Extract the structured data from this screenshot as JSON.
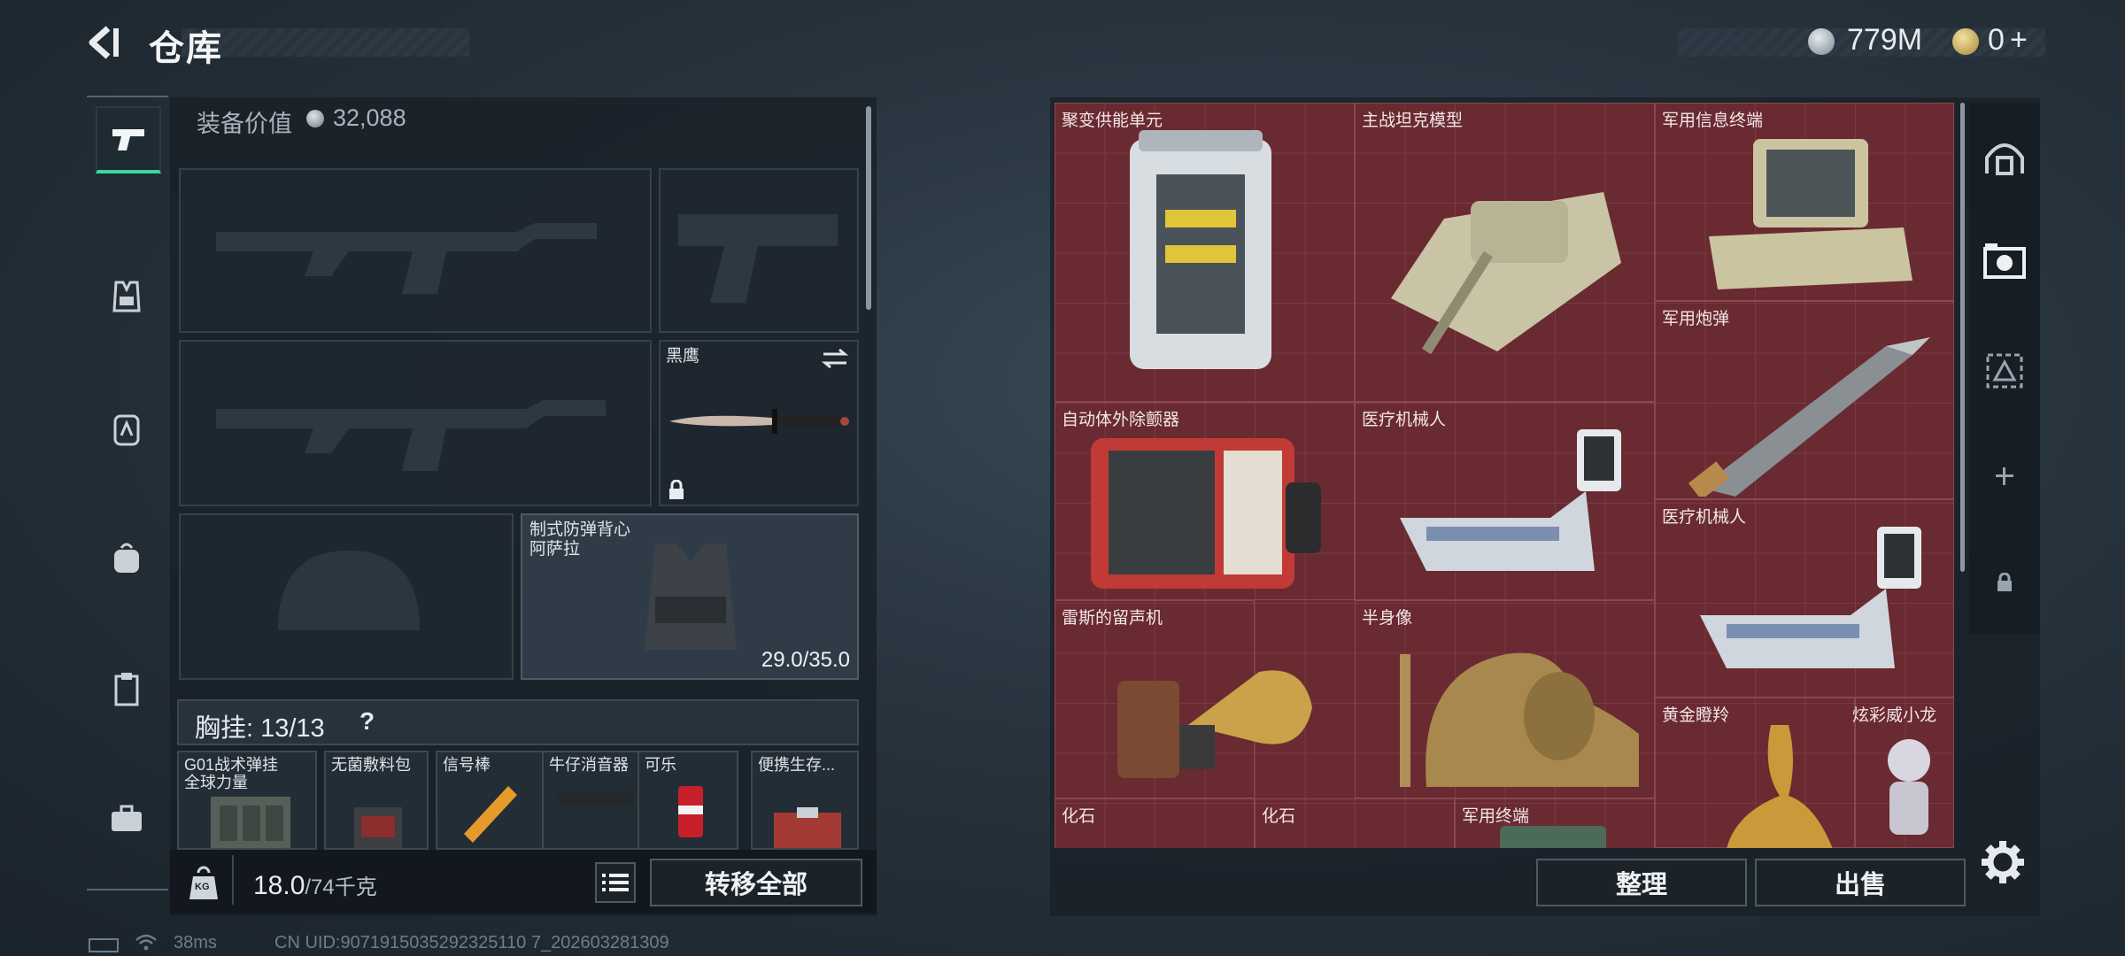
{
  "header": {
    "title": "仓库"
  },
  "currency": {
    "silver": "779M",
    "gold": "0",
    "gold_add": "+"
  },
  "equipment": {
    "value_label": "装备价值",
    "value": "32,088",
    "melee_name": "黑鹰",
    "armor_name_line1": "制式防弹背心",
    "armor_name_line2": "阿萨拉",
    "armor_durability": "29.0/35.0"
  },
  "chest_rig": {
    "label": "胸挂: 13/13",
    "help": "?",
    "items": [
      {
        "label": "G01战术弹挂\n全球力量"
      },
      {
        "label": "无菌敷料包"
      },
      {
        "label": "信号棒"
      },
      {
        "label": "牛仔消音器"
      },
      {
        "label": "可乐"
      },
      {
        "label": "便携生存..."
      }
    ]
  },
  "footer": {
    "weight_icon": "KG",
    "weight": "18.0",
    "weight_max": "/74千克",
    "transfer_all": "转移全部"
  },
  "status": {
    "ping": "38ms",
    "uid": "CN UID:9071915035292325110 7_202603281309"
  },
  "stash": {
    "items": [
      {
        "label": "聚变供能单元"
      },
      {
        "label": "主战坦克模型"
      },
      {
        "label": "军用信息终端"
      },
      {
        "label": "军用炮弹"
      },
      {
        "label": "自动体外除颤器"
      },
      {
        "label": "医疗机械人"
      },
      {
        "label": "医疗机械人"
      },
      {
        "label": "雷斯的留声机"
      },
      {
        "label": "半身像"
      },
      {
        "label": "黄金瞪羚"
      },
      {
        "label": "炫彩威小龙"
      },
      {
        "label": "化石"
      },
      {
        "label": "化石"
      },
      {
        "label": "军用终端"
      }
    ],
    "sort_button": "整理",
    "sell_button": "出售"
  },
  "colors": {
    "accent": "#3fd6a0",
    "stash_bg": "#6a2a31"
  }
}
